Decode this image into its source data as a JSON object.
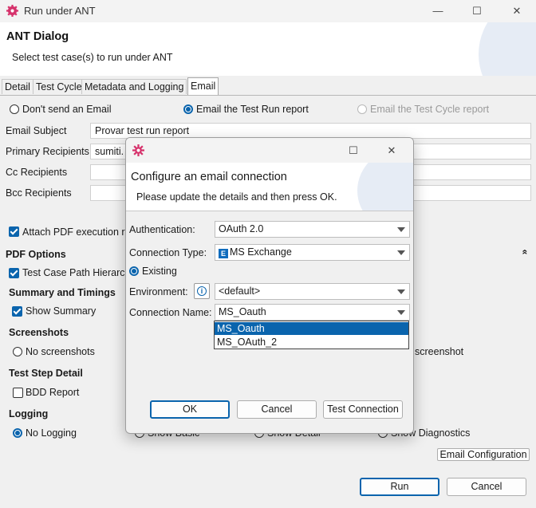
{
  "window": {
    "title": "Run under ANT",
    "minimize": "—",
    "maximize": "☐",
    "close": "✕"
  },
  "header": {
    "title": "ANT Dialog",
    "subtitle": "Select test case(s) to run under ANT"
  },
  "tabs": [
    "Detail",
    "Test Cycle",
    "Metadata and Logging",
    "Email"
  ],
  "email_options": {
    "dont_send": "Don't send an Email",
    "run_report": "Email the Test Run report",
    "cycle_report": "Email the Test Cycle report",
    "selected": "run_report"
  },
  "fields": {
    "subject": {
      "label": "Email Subject",
      "value": "Provar test run report"
    },
    "primary": {
      "label": "Primary Recipients",
      "value": "sumiti."
    },
    "cc": {
      "label": "Cc Recipients",
      "value": ""
    },
    "bcc": {
      "label": "Bcc Recipients",
      "value": ""
    }
  },
  "attach_pdf": {
    "label": "Attach PDF execution re",
    "checked": true
  },
  "pdf_options": {
    "title": "PDF Options",
    "collapse_icon": "«",
    "test_case_path": {
      "label": "Test Case Path Hierarch",
      "checked": true
    }
  },
  "summary": {
    "title": "Summary and Timings",
    "show_summary": {
      "label": "Show Summary",
      "checked": true
    }
  },
  "screenshots": {
    "title": "Screenshots",
    "none": "No screenshots",
    "right_label": "screenshot"
  },
  "test_step": {
    "title": "Test Step Detail",
    "bdd": {
      "label": "BDD Report",
      "checked": false
    }
  },
  "logging": {
    "title": "Logging",
    "options": [
      "No Logging",
      "Show Basic",
      "Show Detail",
      "Show Diagnostics"
    ],
    "selected": "No Logging"
  },
  "email_config_button": "Email Configuration",
  "footer": {
    "run": "Run",
    "cancel": "Cancel"
  },
  "dialog": {
    "title": "Configure an email connection",
    "subtitle": "Please update the details and then press OK.",
    "authentication": {
      "label": "Authentication:",
      "value": "OAuth 2.0"
    },
    "connection_type": {
      "label": "Connection Type:",
      "value": "MS Exchange",
      "icon_text": "E"
    },
    "existing": "Existing",
    "environment": {
      "label": "Environment:",
      "info_icon": "i",
      "value": "<default>"
    },
    "connection_name": {
      "label": "Connection Name:",
      "value": "MS_Oauth"
    },
    "dropdown_options": [
      "MS_Oauth",
      "MS_OAuth_2"
    ],
    "dropdown_selected": 0,
    "buttons": {
      "ok": "OK",
      "cancel": "Cancel",
      "test": "Test Connection"
    }
  },
  "colors": {
    "accent": "#0a64ad",
    "app_icon": "#d6336c"
  }
}
